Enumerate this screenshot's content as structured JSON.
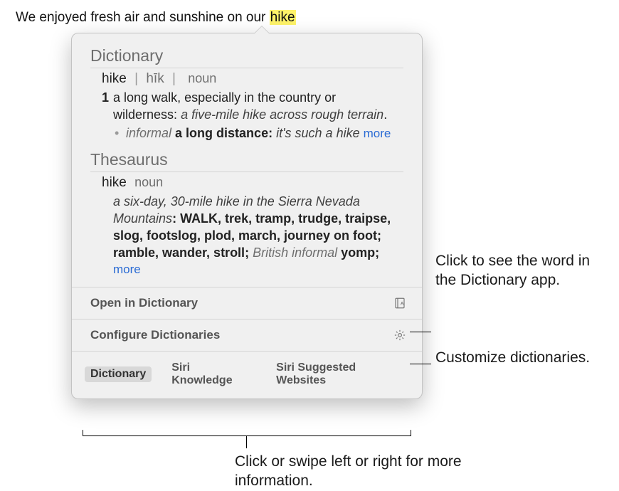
{
  "sentence": {
    "prefix": "We enjoyed fresh air and sunshine on our ",
    "highlight": "hike"
  },
  "popover": {
    "dictionary": {
      "title": "Dictionary",
      "headword": "hike",
      "phonetic": "hīk",
      "pos": "noun",
      "def_num": "1",
      "definition": "a long walk, especially in the country or wilderness:",
      "example": "a five-mile hike across rough terrain",
      "sub_label": "informal",
      "sub_def": "a long distance:",
      "sub_example": "it's such a hike",
      "more": "more"
    },
    "thesaurus": {
      "title": "Thesaurus",
      "headword": "hike",
      "pos": "noun",
      "example": "a six-day, 30-mile hike in the Sierra Nevada Mountains",
      "synonyms": "WALK, trek, tramp, trudge, traipse, slog, footslog, plod, march, journey on foot; ramble, wander, stroll;",
      "regional_label": "British informal",
      "regional_syn": "yomp;",
      "more": "more"
    },
    "actions": {
      "open": "Open in Dictionary",
      "configure": "Configure Dictionaries"
    },
    "tabs": {
      "dictionary": "Dictionary",
      "siri_knowledge": "Siri Knowledge",
      "siri_websites": "Siri Suggested Websites"
    }
  },
  "callouts": {
    "open_app": "Click to see the word in the Dictionary app.",
    "customize": "Customize dictionaries.",
    "tabs": "Click or swipe left or right for more information."
  }
}
